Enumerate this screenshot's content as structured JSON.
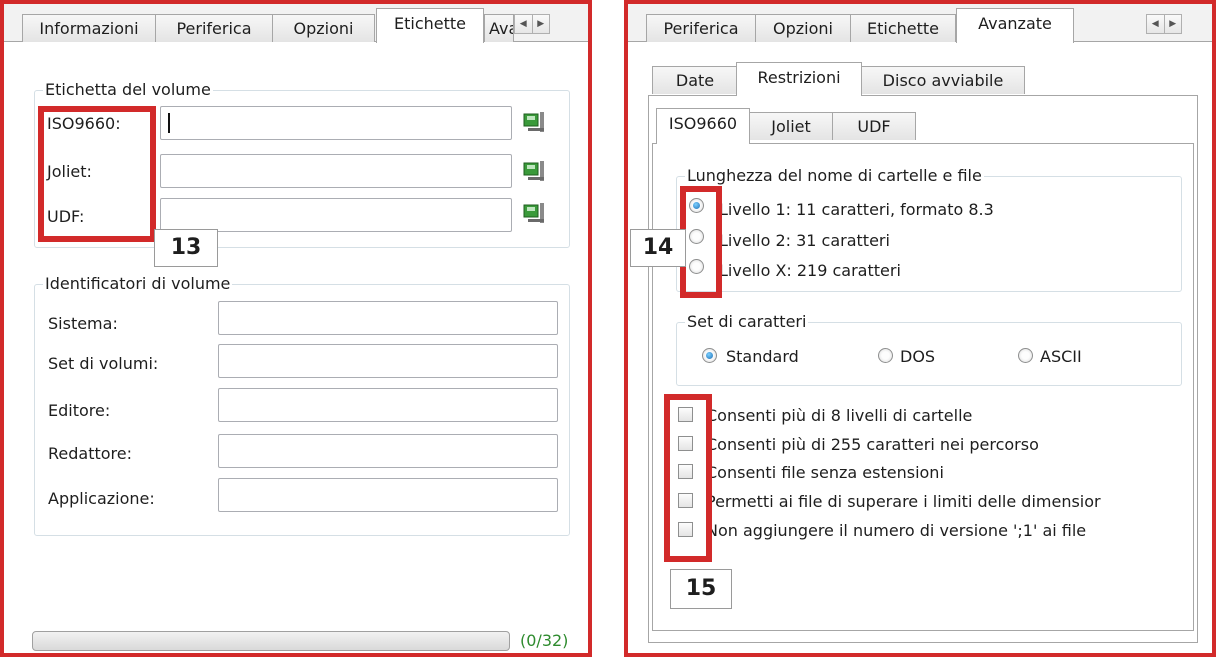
{
  "left_panel": {
    "tabs": [
      "Informazioni",
      "Periferica",
      "Opzioni",
      "Etichette",
      "Avanzate"
    ],
    "active_tab": "Etichette",
    "volume_label_group": {
      "title": "Etichetta del volume",
      "fields": [
        {
          "label": "ISO9660:",
          "value": ""
        },
        {
          "label": "Joliet:",
          "value": ""
        },
        {
          "label": "UDF:",
          "value": ""
        }
      ]
    },
    "volume_identifiers_group": {
      "title": "Identificatori di volume",
      "fields": [
        {
          "label": "Sistema:",
          "value": ""
        },
        {
          "label": "Set di volumi:",
          "value": ""
        },
        {
          "label": "Editore:",
          "value": ""
        },
        {
          "label": "Redattore:",
          "value": ""
        },
        {
          "label": "Applicazione:",
          "value": ""
        }
      ]
    },
    "progress": {
      "text": "(0/32)",
      "fraction": 0.0
    },
    "callout": "13"
  },
  "right_panel": {
    "tabs": [
      "Periferica",
      "Opzioni",
      "Etichette",
      "Avanzate"
    ],
    "active_tab": "Avanzate",
    "subtabs": [
      "Date",
      "Restrizioni",
      "Disco avviabile"
    ],
    "active_subtab": "Restrizioni",
    "fs_tabs": [
      "ISO9660",
      "Joliet",
      "UDF"
    ],
    "active_fs_tab": "ISO9660",
    "name_length_group": {
      "title": "Lunghezza del nome di cartelle e file",
      "options": [
        {
          "label": "Livello 1: 11 caratteri, formato 8.3",
          "selected": true
        },
        {
          "label": "Livello 2: 31 caratteri",
          "selected": false
        },
        {
          "label": "Livello X: 219 caratteri",
          "selected": false
        }
      ]
    },
    "charset_group": {
      "title": "Set di caratteri",
      "options": [
        {
          "label": "Standard",
          "selected": true
        },
        {
          "label": "DOS",
          "selected": false
        },
        {
          "label": "ASCII",
          "selected": false
        }
      ]
    },
    "checkboxes": [
      {
        "label": "Consenti più di 8 livelli di cartelle",
        "checked": false
      },
      {
        "label": "Consenti più di 255 caratteri nei percorso",
        "checked": false
      },
      {
        "label": "Consenti file senza estensioni",
        "checked": false
      },
      {
        "label": "Permetti ai file di superare i limiti delle dimensior",
        "checked": false
      },
      {
        "label": "Non aggiungere il numero di versione ';1' ai file",
        "checked": false
      }
    ],
    "callouts": [
      "14",
      "15"
    ]
  },
  "colors": {
    "highlight": "#d22a2a",
    "progress_text": "#2e8b2e",
    "radio_selected": "#1f6fb5"
  },
  "icons": [
    "filesystem-label-icon"
  ]
}
